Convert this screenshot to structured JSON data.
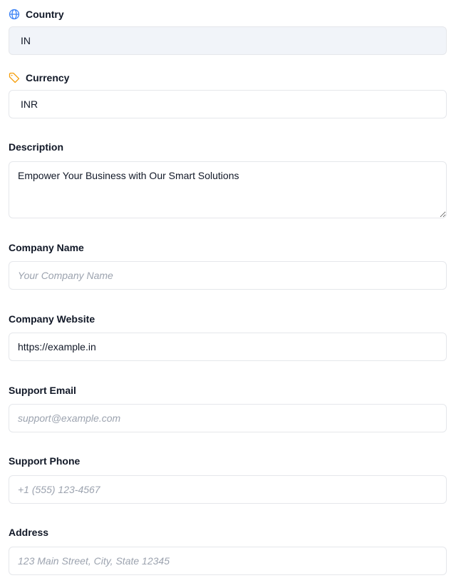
{
  "country": {
    "label": "Country",
    "value": "IN",
    "icon": "globe-icon",
    "icon_color": "#3b82f6"
  },
  "currency": {
    "label": "Currency",
    "value": "INR",
    "icon": "tag-icon",
    "icon_color": "#f59e0b"
  },
  "description": {
    "label": "Description",
    "value": "Empower Your Business with Our Smart Solutions"
  },
  "company_name": {
    "label": "Company Name",
    "value": "",
    "placeholder": "Your Company Name"
  },
  "company_website": {
    "label": "Company Website",
    "value": "https://example.in"
  },
  "support_email": {
    "label": "Support Email",
    "value": "",
    "placeholder": "support@example.com"
  },
  "support_phone": {
    "label": "Support Phone",
    "value": "",
    "placeholder": "+1 (555) 123-4567"
  },
  "address": {
    "label": "Address",
    "value": "",
    "placeholder": "123 Main Street, City, State 12345"
  }
}
